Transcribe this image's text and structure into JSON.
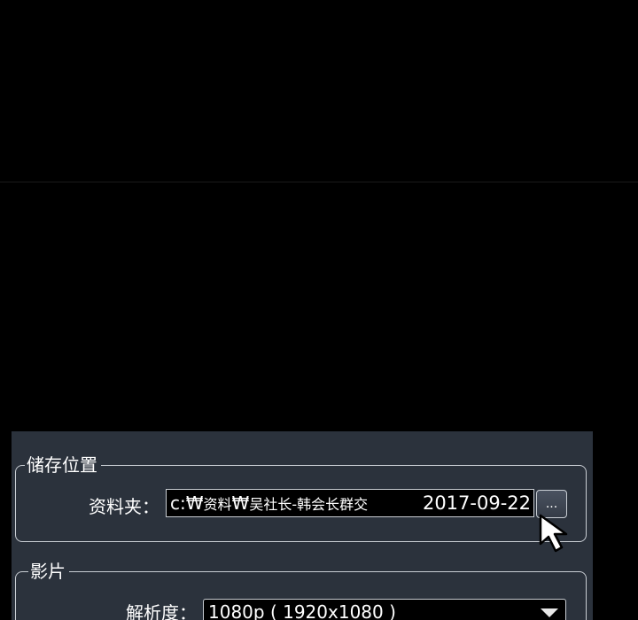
{
  "storage_group": {
    "title": "储存位置",
    "folder_label": "资料夹：",
    "folder_path_drive": "c:",
    "folder_path_sep1": "₩",
    "folder_path_seg1": "资料",
    "folder_path_sep2": "₩",
    "folder_path_seg2": "吴社长-韩会长群交",
    "folder_path_date": "2017-09-22",
    "browse_button_label": "..."
  },
  "video_group": {
    "title": "影片",
    "resolution_label": "解析度：",
    "resolution_value": "1080p ( 1920x1080 )"
  },
  "icons": {
    "cursor": "arrow-cursor-icon",
    "dropdown": "triangle-down-icon"
  },
  "colors": {
    "panel_bg": "#2b323c",
    "border": "#c9ced4",
    "field_bg": "#000000",
    "text": "#ffffff"
  }
}
